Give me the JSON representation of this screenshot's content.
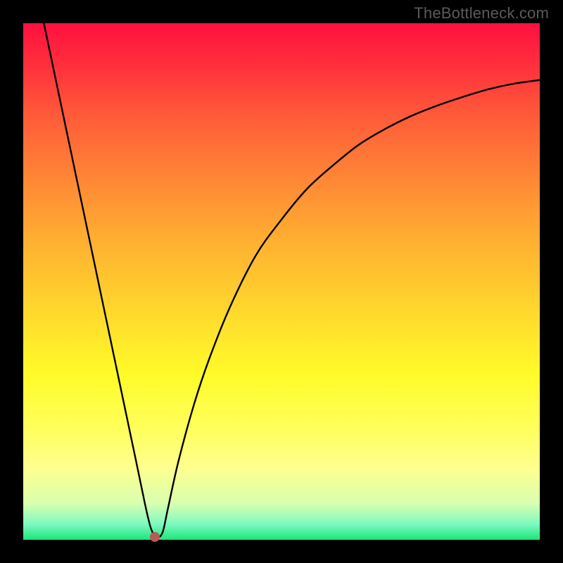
{
  "watermark": "TheBottleneck.com",
  "chart_data": {
    "type": "line",
    "title": "",
    "xlabel": "",
    "ylabel": "",
    "xlim": [
      0,
      100
    ],
    "ylim": [
      0,
      100
    ],
    "series": [
      {
        "name": "curve",
        "x": [
          4,
          6,
          8,
          10,
          12,
          14,
          16,
          18,
          20,
          22,
          24,
          25,
          26,
          27,
          28,
          30,
          33,
          36,
          40,
          45,
          50,
          55,
          60,
          65,
          70,
          75,
          80,
          85,
          90,
          95,
          100
        ],
        "y": [
          100,
          90.5,
          81,
          71.5,
          62,
          52.5,
          43,
          33.5,
          24,
          14.5,
          5,
          1.5,
          0.5,
          1.5,
          6,
          15,
          26,
          35,
          45,
          55,
          62,
          68,
          72.5,
          76.5,
          79.5,
          82,
          84,
          85.7,
          87.2,
          88.3,
          89
        ]
      }
    ],
    "marker": {
      "x": 25.5,
      "y": 0.5,
      "color": "#b85a58"
    },
    "background_gradient": {
      "top": "#ff103f",
      "bottom": "#1be67a"
    }
  }
}
